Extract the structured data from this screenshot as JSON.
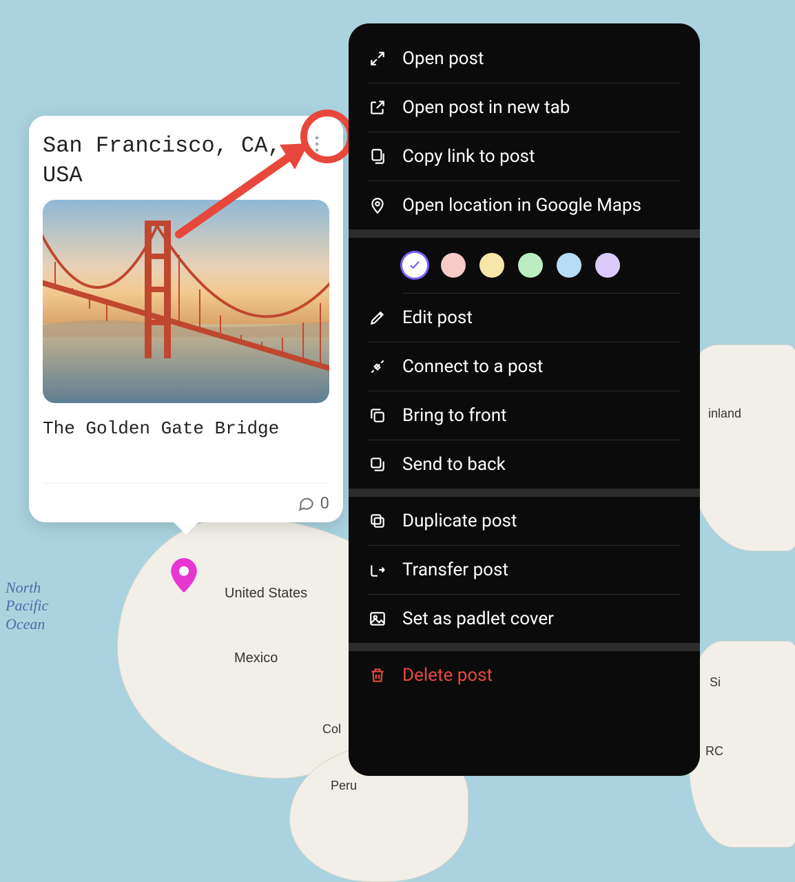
{
  "map": {
    "ocean_label": "North\nPacific\nOcean",
    "labels": {
      "usa": "United States",
      "mexico": "Mexico",
      "col": "Col",
      "peru": "Peru",
      "inland": "inland",
      "rc": "RC",
      "si": "Si"
    }
  },
  "post": {
    "title": "San Francisco, CA, USA",
    "caption": "The Golden Gate Bridge",
    "comment_count": "0"
  },
  "menu": {
    "open_post": "Open post",
    "open_new_tab": "Open post in new tab",
    "copy_link": "Copy link to post",
    "open_maps": "Open location in Google Maps",
    "edit_post": "Edit post",
    "connect_post": "Connect to a post",
    "bring_front": "Bring to front",
    "send_back": "Send to back",
    "duplicate": "Duplicate post",
    "transfer": "Transfer post",
    "set_cover": "Set as padlet cover",
    "delete": "Delete post"
  },
  "colors": {
    "white": "#ffffff",
    "pink": "#f8c9c9",
    "yellow": "#f6e7a9",
    "green": "#bcecc2",
    "blue": "#b7dcf7",
    "purple": "#d9caf6",
    "selected_ring": "#7b5cff"
  }
}
